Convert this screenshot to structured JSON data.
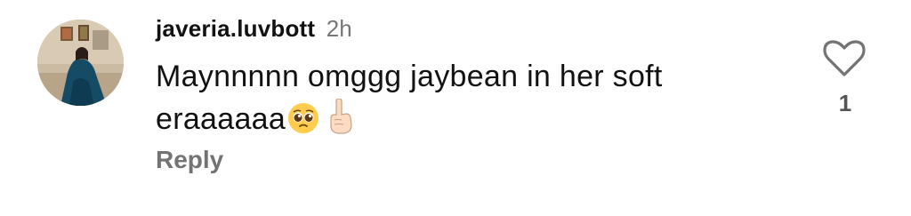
{
  "comment": {
    "username": "javeria.luvbott",
    "timestamp": "2h",
    "text_line1": "Maynnnnn omggg jaybean in her soft",
    "text_line2": "eraaaaaa",
    "emojis": [
      "pleading-face-emoji",
      "index-pointing-up-emoji"
    ],
    "reply_label": "Reply",
    "like_count": "1",
    "like_icon": "heart-outline-icon"
  },
  "colors": {
    "text": "#121212",
    "secondary": "#777777",
    "reply": "#737373"
  }
}
